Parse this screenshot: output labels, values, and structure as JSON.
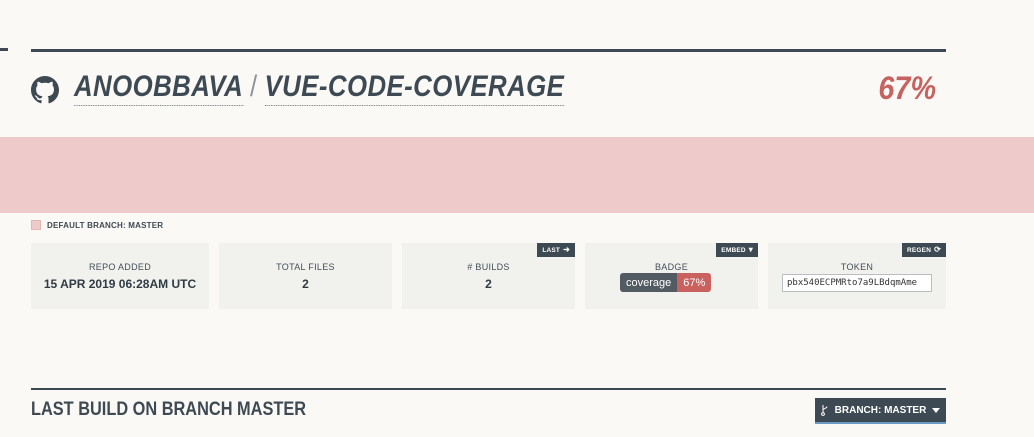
{
  "repo": {
    "owner": "ANOOBBAVA",
    "separator": "/",
    "name": "VUE-CODE-COVERAGE",
    "coverage": "67%",
    "icon": "github-icon"
  },
  "colors": {
    "accent": "#3e4a53",
    "coverage": "#c6625f",
    "chart_fill": "#eecbca",
    "background": "#fbf9f6"
  },
  "default_branch_label": "DEFAULT BRANCH: MASTER",
  "stats": {
    "repo_added": {
      "label": "REPO ADDED",
      "value": "15 APR 2019 06:28AM UTC"
    },
    "total_files": {
      "label": "TOTAL FILES",
      "value": "2"
    },
    "builds": {
      "label": "# BUILDS",
      "value": "2",
      "tab": "LAST",
      "tab_icon": "arrow-circle-right-icon"
    },
    "badge": {
      "label": "BADGE",
      "tab": "EMBED",
      "tab_icon": "caret-down-icon",
      "left": "coverage",
      "right": "67%"
    },
    "token": {
      "label": "TOKEN",
      "tab": "REGEN",
      "tab_icon": "refresh-icon",
      "value": "pbx540ECPMRto7a9LBdqmAme"
    }
  },
  "last_build": {
    "title": "LAST BUILD ON BRANCH MASTER",
    "branch_button": "BRANCH: MASTER",
    "branch_icon": "git-branch-icon"
  }
}
